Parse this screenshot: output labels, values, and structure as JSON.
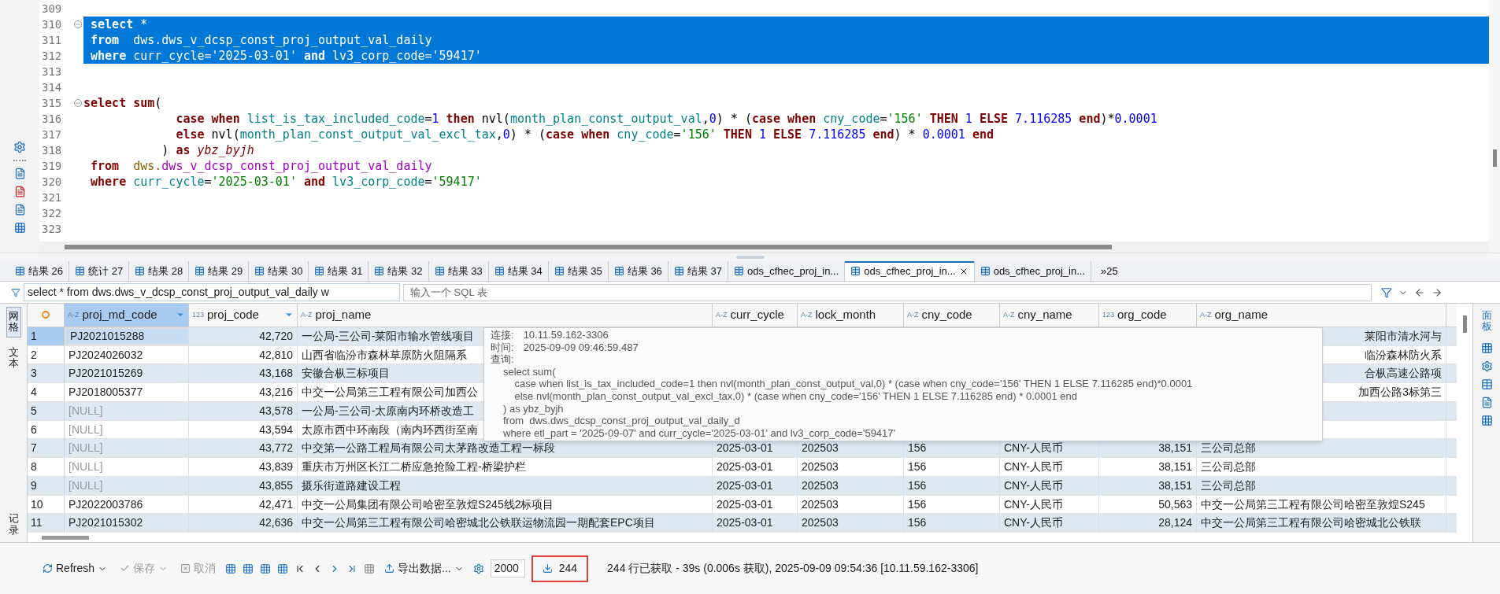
{
  "editor": {
    "lines": [
      {
        "num": "309",
        "fold": false,
        "selected": false
      },
      {
        "num": "310",
        "fold": true,
        "selected": true,
        "tokens": [
          {
            "kind": "keyword",
            "text": " select"
          },
          {
            "kind": "plain",
            "text": " *"
          }
        ]
      },
      {
        "num": "311",
        "fold": false,
        "selected": true,
        "tokens": [
          {
            "kind": "keyword",
            "text": " from"
          },
          {
            "kind": "plain",
            "text": "  dws.dws_v_dcsp_const_proj_output_val_daily"
          }
        ]
      },
      {
        "num": "312",
        "fold": false,
        "selected": true,
        "tokens": [
          {
            "kind": "keyword",
            "text": " where"
          },
          {
            "kind": "plain",
            "text": " curr_cycle='2025-03-01' "
          },
          {
            "kind": "keyword",
            "text": "and"
          },
          {
            "kind": "plain",
            "text": " lv3_corp_code='59417'"
          }
        ]
      },
      {
        "num": "313",
        "fold": false,
        "selected": false
      },
      {
        "num": "314",
        "fold": false,
        "selected": false
      },
      {
        "num": "315",
        "fold": true,
        "selected": false,
        "tokens": [
          {
            "kind": "keyword",
            "text": "select sum"
          },
          {
            "kind": "plain",
            "text": "("
          }
        ]
      },
      {
        "num": "316",
        "fold": false,
        "selected": false,
        "tokens": [
          {
            "kind": "keyword",
            "text": "             case when"
          },
          {
            "kind": "ident",
            "text": " list_is_tax_included_code"
          },
          {
            "kind": "plain",
            "text": "="
          },
          {
            "kind": "number",
            "text": "1"
          },
          {
            "kind": "keyword",
            "text": " then"
          },
          {
            "kind": "plain",
            "text": " nvl("
          },
          {
            "kind": "ident",
            "text": "month_plan_const_output_val"
          },
          {
            "kind": "plain",
            "text": ","
          },
          {
            "kind": "number",
            "text": "0"
          },
          {
            "kind": "plain",
            "text": ") * ("
          },
          {
            "kind": "keyword",
            "text": "case when"
          },
          {
            "kind": "ident",
            "text": " cny_code"
          },
          {
            "kind": "plain",
            "text": "="
          },
          {
            "kind": "string",
            "text": "'156'"
          },
          {
            "kind": "keyword",
            "text": " THEN"
          },
          {
            "kind": "number",
            "text": " 1"
          },
          {
            "kind": "keyword",
            "text": " ELSE"
          },
          {
            "kind": "number",
            "text": " 7.116285"
          },
          {
            "kind": "keyword",
            "text": " end"
          },
          {
            "kind": "plain",
            "text": ")*"
          },
          {
            "kind": "number",
            "text": "0.0001"
          }
        ]
      },
      {
        "num": "317",
        "fold": false,
        "selected": false,
        "tokens": [
          {
            "kind": "keyword",
            "text": "             else"
          },
          {
            "kind": "plain",
            "text": " nvl("
          },
          {
            "kind": "ident",
            "text": "month_plan_const_output_val_excl_tax"
          },
          {
            "kind": "plain",
            "text": ","
          },
          {
            "kind": "number",
            "text": "0"
          },
          {
            "kind": "plain",
            "text": ") * ("
          },
          {
            "kind": "keyword",
            "text": "case when"
          },
          {
            "kind": "ident",
            "text": " cny_code"
          },
          {
            "kind": "plain",
            "text": "="
          },
          {
            "kind": "string",
            "text": "'156'"
          },
          {
            "kind": "keyword",
            "text": " THEN"
          },
          {
            "kind": "number",
            "text": " 1"
          },
          {
            "kind": "keyword",
            "text": " ELSE"
          },
          {
            "kind": "number",
            "text": " 7.116285"
          },
          {
            "kind": "keyword",
            "text": " end"
          },
          {
            "kind": "plain",
            "text": ") * "
          },
          {
            "kind": "number",
            "text": "0.0001"
          },
          {
            "kind": "keyword",
            "text": " end"
          }
        ]
      },
      {
        "num": "318",
        "fold": false,
        "selected": false,
        "tokens": [
          {
            "kind": "plain",
            "text": "           ) "
          },
          {
            "kind": "keyword",
            "text": "as"
          },
          {
            "kind": "alias",
            "text": " ybz_byjh"
          }
        ]
      },
      {
        "num": "319",
        "fold": false,
        "selected": false,
        "tokens": [
          {
            "kind": "keyword",
            "text": " from"
          },
          {
            "kind": "schema",
            "text": "  dws."
          },
          {
            "kind": "table",
            "text": "dws_v_dcsp_const_proj_output_val_daily"
          }
        ]
      },
      {
        "num": "320",
        "fold": false,
        "selected": false,
        "tokens": [
          {
            "kind": "keyword",
            "text": " where"
          },
          {
            "kind": "ident",
            "text": " curr_cycle"
          },
          {
            "kind": "plain",
            "text": "="
          },
          {
            "kind": "string",
            "text": "'2025-03-01'"
          },
          {
            "kind": "keyword",
            "text": " and"
          },
          {
            "kind": "ident",
            "text": " lv3_corp_code"
          },
          {
            "kind": "plain",
            "text": "="
          },
          {
            "kind": "string",
            "text": "'59417'"
          }
        ]
      },
      {
        "num": "321",
        "fold": false,
        "selected": false
      },
      {
        "num": "322",
        "fold": false,
        "selected": false
      },
      {
        "num": "323",
        "fold": false,
        "selected": false
      }
    ]
  },
  "result_tabs": [
    {
      "label": "结果 26",
      "selected": false
    },
    {
      "label": "统计 27",
      "selected": false
    },
    {
      "label": "结果 28",
      "selected": false
    },
    {
      "label": "结果 29",
      "selected": false
    },
    {
      "label": "结果 30",
      "selected": false
    },
    {
      "label": "结果 31",
      "selected": false
    },
    {
      "label": "结果 32",
      "selected": false
    },
    {
      "label": "结果 33",
      "selected": false
    },
    {
      "label": "结果 34",
      "selected": false
    },
    {
      "label": "结果 35",
      "selected": false
    },
    {
      "label": "结果 36",
      "selected": false
    },
    {
      "label": "结果 37",
      "selected": false
    },
    {
      "label": "ods_cfhec_proj_in...",
      "selected": false
    },
    {
      "label": "ods_cfhec_proj_in...",
      "selected": true
    },
    {
      "label": "ods_cfhec_proj_in...",
      "selected": false
    }
  ],
  "tabs_overflow": "»25",
  "filter": {
    "value": "select * from dws.dws_v_dcsp_const_proj_output_val_daily w",
    "placeholder": "输入一个 SQL 表"
  },
  "side_tabs": [
    {
      "label": "网格",
      "selected": true
    },
    {
      "label": "文本",
      "selected": false
    },
    {
      "label": "记录",
      "selected": false
    }
  ],
  "right_panel": {
    "label": "面板"
  },
  "table": {
    "columns": [
      {
        "name": "proj_md_code",
        "type": "A-Z",
        "selected": true
      },
      {
        "name": "proj_code",
        "type": "123",
        "selected": false
      },
      {
        "name": "proj_name",
        "type": "A-Z",
        "selected": false
      },
      {
        "name": "curr_cycle",
        "type": "A-Z",
        "selected": false
      },
      {
        "name": "lock_month",
        "type": "A-Z",
        "selected": false
      },
      {
        "name": "cny_code",
        "type": "A-Z",
        "selected": false
      },
      {
        "name": "cny_name",
        "type": "A-Z",
        "selected": false
      },
      {
        "name": "org_code",
        "type": "123",
        "selected": false
      },
      {
        "name": "org_name",
        "type": "A-Z",
        "selected": false
      }
    ],
    "rows": [
      {
        "num": "1",
        "selected": true,
        "null": false,
        "covered": true,
        "cells": [
          "PJ2021015288",
          "42,720",
          "一公局-三公司-莱阳市输水管线项目",
          null,
          null,
          null,
          null,
          null,
          "莱阳市清水河与"
        ]
      },
      {
        "num": "2",
        "selected": false,
        "null": false,
        "covered": true,
        "cells": [
          "PJ2024026032",
          "42,810",
          "山西省临汾市森林草原防火阻隔系",
          null,
          null,
          null,
          null,
          null,
          "临汾森林防火系"
        ]
      },
      {
        "num": "3",
        "selected": false,
        "null": false,
        "covered": true,
        "cells": [
          "PJ2021015269",
          "43,168",
          "安徽合枞三标项目",
          null,
          null,
          null,
          null,
          null,
          "合枞高速公路项"
        ]
      },
      {
        "num": "4",
        "selected": false,
        "null": false,
        "covered": true,
        "cells": [
          "PJ2018005377",
          "43,216",
          "中交一公局第三工程有限公司加西公",
          null,
          null,
          null,
          null,
          null,
          "加西公路3标第三"
        ]
      },
      {
        "num": "5",
        "selected": false,
        "null": true,
        "covered": true,
        "cells": [
          "[NULL]",
          "43,578",
          "一公局-三公司-太原南内环桥改造工",
          null,
          null,
          null,
          null,
          null,
          null
        ]
      },
      {
        "num": "6",
        "selected": false,
        "null": true,
        "covered": true,
        "cells": [
          "[NULL]",
          "43,594",
          "太原市西中环南段（南内环西街至南",
          null,
          null,
          null,
          null,
          null,
          null
        ]
      },
      {
        "num": "7",
        "selected": false,
        "null": true,
        "covered": false,
        "cells": [
          "[NULL]",
          "43,772",
          "中交第一公路工程局有限公司太茅路改造工程一标段",
          "2025-03-01",
          "202503",
          "156",
          "CNY-人民币",
          "38,151",
          "三公司总部"
        ]
      },
      {
        "num": "8",
        "selected": false,
        "null": true,
        "covered": false,
        "cells": [
          "[NULL]",
          "43,839",
          "重庆市万州区长江二桥应急抢险工程-桥梁护栏",
          "2025-03-01",
          "202503",
          "156",
          "CNY-人民币",
          "38,151",
          "三公司总部"
        ]
      },
      {
        "num": "9",
        "selected": false,
        "null": true,
        "covered": false,
        "cells": [
          "[NULL]",
          "43,855",
          "摄乐街道路建设工程",
          "2025-03-01",
          "202503",
          "156",
          "CNY-人民币",
          "38,151",
          "三公司总部"
        ]
      },
      {
        "num": "10",
        "selected": false,
        "null": false,
        "covered": false,
        "cells": [
          "PJ2022003786",
          "42,471",
          "中交一公局集团有限公司哈密至敦煌S245线2标项目",
          "2025-03-01",
          "202503",
          "156",
          "CNY-人民币",
          "50,563",
          "中交一公局第三工程有限公司哈密至敦煌S245"
        ]
      },
      {
        "num": "11",
        "selected": false,
        "null": false,
        "covered": false,
        "cells": [
          "PJ2021015302",
          "42,636",
          "中交一公局第三工程有限公司哈密城北公铁联运物流园一期配套EPC项目",
          "2025-03-01",
          "202503",
          "156",
          "CNY-人民币",
          "28,124",
          "中交一公局第三工程有限公司哈密城北公铁联"
        ]
      }
    ]
  },
  "tooltip": {
    "fields": [
      {
        "label": "连接:",
        "value": "10.11.59.162-3306"
      },
      {
        "label": "时间:",
        "value": "2025-09-09 09:46:59.487"
      }
    ],
    "query_label": "查询:",
    "query": [
      "select sum(",
      "    case when list_is_tax_included_code=1 then nvl(month_plan_const_output_val,0) * (case when cny_code='156' THEN 1 ELSE 7.116285 end)*0.0001",
      "    else nvl(month_plan_const_output_val_excl_tax,0) * (case when cny_code='156' THEN 1 ELSE 7.116285 end) * 0.0001 end",
      ") as ybz_byjh",
      "from  dws.dws_dcsp_const_proj_output_val_daily_d",
      "where etl_part = '2025-09-07' and curr_cycle='2025-03-01' and lv3_corp_code='59417'"
    ]
  },
  "toolbar": {
    "refresh": {
      "label": "Refresh",
      "disabled": false
    },
    "save": {
      "label": "保存",
      "disabled": true
    },
    "cancel": {
      "label": "取消",
      "disabled": true
    },
    "export": {
      "label": "导出数据..."
    },
    "fetch_size": "2000",
    "row_count": "244",
    "status": "244 行已获取 - 39s (0.006s 获取), 2025-09-09 09:54:36 [10.11.59.162-3306]"
  }
}
